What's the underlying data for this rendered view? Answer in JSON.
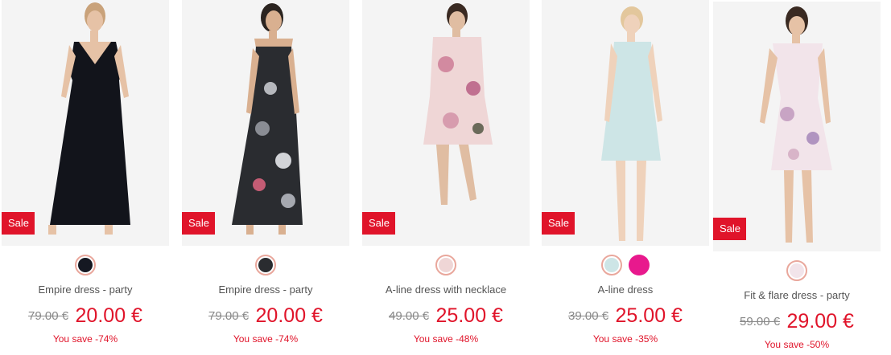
{
  "colors": {
    "sale_red": "#e0142a",
    "swatch_ring": "#e9a79c"
  },
  "products": [
    {
      "sale_label": "Sale",
      "name": "Empire dress - party",
      "old_price": "79.00 €",
      "new_price": "20.00 €",
      "savings": "You save -74%",
      "swatches": [
        "#151822"
      ]
    },
    {
      "sale_label": "Sale",
      "name": "Empire dress - party",
      "old_price": "79.00 €",
      "new_price": "20.00 €",
      "savings": "You save -74%",
      "swatches": [
        "#2a2c30"
      ]
    },
    {
      "sale_label": "Sale",
      "name": "A-line dress with necklace",
      "old_price": "49.00 €",
      "new_price": "25.00 €",
      "savings": "You save -48%",
      "swatches": [
        "#efd6d6"
      ]
    },
    {
      "sale_label": "Sale",
      "name": "A-line dress",
      "old_price": "39.00 €",
      "new_price": "25.00 €",
      "savings": "You save -35%",
      "swatches": [
        "#cde5e6",
        "#e8198d"
      ]
    },
    {
      "sale_label": "Sale",
      "name": "Fit & flare dress - party",
      "old_price": "59.00 €",
      "new_price": "29.00 €",
      "savings": "You save -50%",
      "swatches": [
        "#f2e4ea"
      ]
    }
  ]
}
